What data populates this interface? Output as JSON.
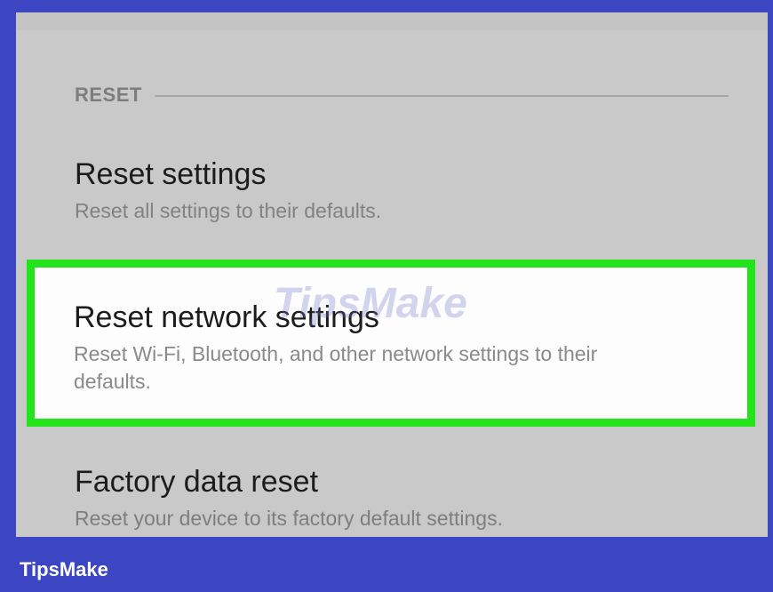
{
  "section": {
    "title": "RESET"
  },
  "items": [
    {
      "title": "Reset settings",
      "subtitle": "Reset all settings to their defaults."
    },
    {
      "title": "Reset network settings",
      "subtitle": "Reset Wi-Fi, Bluetooth, and other network settings to their defaults."
    },
    {
      "title": "Factory data reset",
      "subtitle": "Reset your device to its factory default settings."
    }
  ],
  "highlight_color": "#23e41a",
  "watermark": "TipsMake",
  "footer": {
    "brand": "TipsMake"
  }
}
